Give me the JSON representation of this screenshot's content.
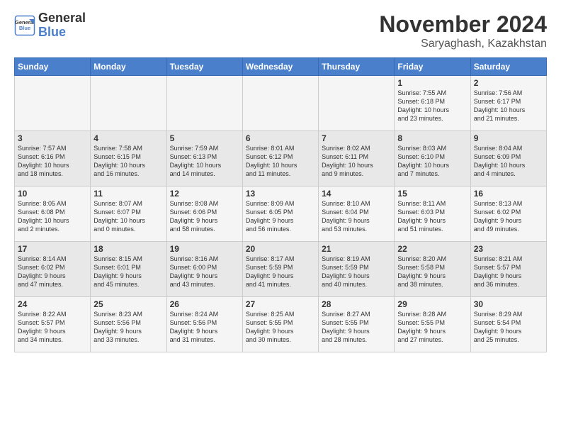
{
  "header": {
    "logo_line1": "General",
    "logo_line2": "Blue",
    "title": "November 2024",
    "location": "Saryaghash, Kazakhstan"
  },
  "weekdays": [
    "Sunday",
    "Monday",
    "Tuesday",
    "Wednesday",
    "Thursday",
    "Friday",
    "Saturday"
  ],
  "weeks": [
    [
      {
        "day": "",
        "info": ""
      },
      {
        "day": "",
        "info": ""
      },
      {
        "day": "",
        "info": ""
      },
      {
        "day": "",
        "info": ""
      },
      {
        "day": "",
        "info": ""
      },
      {
        "day": "1",
        "info": "Sunrise: 7:55 AM\nSunset: 6:18 PM\nDaylight: 10 hours\nand 23 minutes."
      },
      {
        "day": "2",
        "info": "Sunrise: 7:56 AM\nSunset: 6:17 PM\nDaylight: 10 hours\nand 21 minutes."
      }
    ],
    [
      {
        "day": "3",
        "info": "Sunrise: 7:57 AM\nSunset: 6:16 PM\nDaylight: 10 hours\nand 18 minutes."
      },
      {
        "day": "4",
        "info": "Sunrise: 7:58 AM\nSunset: 6:15 PM\nDaylight: 10 hours\nand 16 minutes."
      },
      {
        "day": "5",
        "info": "Sunrise: 7:59 AM\nSunset: 6:13 PM\nDaylight: 10 hours\nand 14 minutes."
      },
      {
        "day": "6",
        "info": "Sunrise: 8:01 AM\nSunset: 6:12 PM\nDaylight: 10 hours\nand 11 minutes."
      },
      {
        "day": "7",
        "info": "Sunrise: 8:02 AM\nSunset: 6:11 PM\nDaylight: 10 hours\nand 9 minutes."
      },
      {
        "day": "8",
        "info": "Sunrise: 8:03 AM\nSunset: 6:10 PM\nDaylight: 10 hours\nand 7 minutes."
      },
      {
        "day": "9",
        "info": "Sunrise: 8:04 AM\nSunset: 6:09 PM\nDaylight: 10 hours\nand 4 minutes."
      }
    ],
    [
      {
        "day": "10",
        "info": "Sunrise: 8:05 AM\nSunset: 6:08 PM\nDaylight: 10 hours\nand 2 minutes."
      },
      {
        "day": "11",
        "info": "Sunrise: 8:07 AM\nSunset: 6:07 PM\nDaylight: 10 hours\nand 0 minutes."
      },
      {
        "day": "12",
        "info": "Sunrise: 8:08 AM\nSunset: 6:06 PM\nDaylight: 9 hours\nand 58 minutes."
      },
      {
        "day": "13",
        "info": "Sunrise: 8:09 AM\nSunset: 6:05 PM\nDaylight: 9 hours\nand 56 minutes."
      },
      {
        "day": "14",
        "info": "Sunrise: 8:10 AM\nSunset: 6:04 PM\nDaylight: 9 hours\nand 53 minutes."
      },
      {
        "day": "15",
        "info": "Sunrise: 8:11 AM\nSunset: 6:03 PM\nDaylight: 9 hours\nand 51 minutes."
      },
      {
        "day": "16",
        "info": "Sunrise: 8:13 AM\nSunset: 6:02 PM\nDaylight: 9 hours\nand 49 minutes."
      }
    ],
    [
      {
        "day": "17",
        "info": "Sunrise: 8:14 AM\nSunset: 6:02 PM\nDaylight: 9 hours\nand 47 minutes."
      },
      {
        "day": "18",
        "info": "Sunrise: 8:15 AM\nSunset: 6:01 PM\nDaylight: 9 hours\nand 45 minutes."
      },
      {
        "day": "19",
        "info": "Sunrise: 8:16 AM\nSunset: 6:00 PM\nDaylight: 9 hours\nand 43 minutes."
      },
      {
        "day": "20",
        "info": "Sunrise: 8:17 AM\nSunset: 5:59 PM\nDaylight: 9 hours\nand 41 minutes."
      },
      {
        "day": "21",
        "info": "Sunrise: 8:19 AM\nSunset: 5:59 PM\nDaylight: 9 hours\nand 40 minutes."
      },
      {
        "day": "22",
        "info": "Sunrise: 8:20 AM\nSunset: 5:58 PM\nDaylight: 9 hours\nand 38 minutes."
      },
      {
        "day": "23",
        "info": "Sunrise: 8:21 AM\nSunset: 5:57 PM\nDaylight: 9 hours\nand 36 minutes."
      }
    ],
    [
      {
        "day": "24",
        "info": "Sunrise: 8:22 AM\nSunset: 5:57 PM\nDaylight: 9 hours\nand 34 minutes."
      },
      {
        "day": "25",
        "info": "Sunrise: 8:23 AM\nSunset: 5:56 PM\nDaylight: 9 hours\nand 33 minutes."
      },
      {
        "day": "26",
        "info": "Sunrise: 8:24 AM\nSunset: 5:56 PM\nDaylight: 9 hours\nand 31 minutes."
      },
      {
        "day": "27",
        "info": "Sunrise: 8:25 AM\nSunset: 5:55 PM\nDaylight: 9 hours\nand 30 minutes."
      },
      {
        "day": "28",
        "info": "Sunrise: 8:27 AM\nSunset: 5:55 PM\nDaylight: 9 hours\nand 28 minutes."
      },
      {
        "day": "29",
        "info": "Sunrise: 8:28 AM\nSunset: 5:55 PM\nDaylight: 9 hours\nand 27 minutes."
      },
      {
        "day": "30",
        "info": "Sunrise: 8:29 AM\nSunset: 5:54 PM\nDaylight: 9 hours\nand 25 minutes."
      }
    ]
  ]
}
